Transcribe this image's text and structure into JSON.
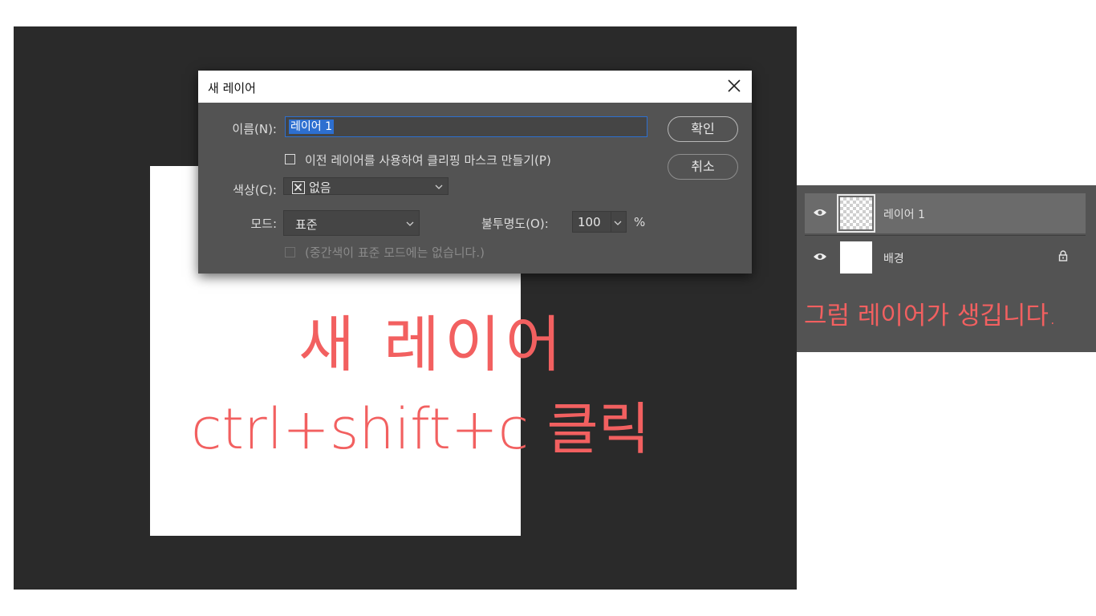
{
  "dialog": {
    "title": "새 레이어",
    "name_label": "이름(N):",
    "name_value": "레이어 1",
    "clipping_mask_label": "이전 레이어를 사용하여 클리핑 마스크 만들기(P)",
    "color_label": "색상(C):",
    "color_value": "없음",
    "mode_label": "모드:",
    "mode_value": "표준",
    "opacity_label": "불투명도(O):",
    "opacity_value": "100",
    "opacity_unit": "%",
    "neutral_color_label": "(중간색이 표준 모드에는 없습니다.)",
    "ok_label": "확인",
    "cancel_label": "취소"
  },
  "annotations": {
    "line1": "새 레이어",
    "line2": "ctrl+shift+c 클릭",
    "panel_note": "그럼 레이어가 생깁니다."
  },
  "layers": [
    {
      "name": "레이어 1",
      "thumbnail": "transparent",
      "visible": true,
      "selected": true
    },
    {
      "name": "배경",
      "thumbnail": "white",
      "visible": true,
      "locked": true
    }
  ],
  "colors": {
    "workspace": "#2a2a2a",
    "dialog_bg": "#535353",
    "accent": "#2d6fd0",
    "annotation": "#f26060"
  }
}
